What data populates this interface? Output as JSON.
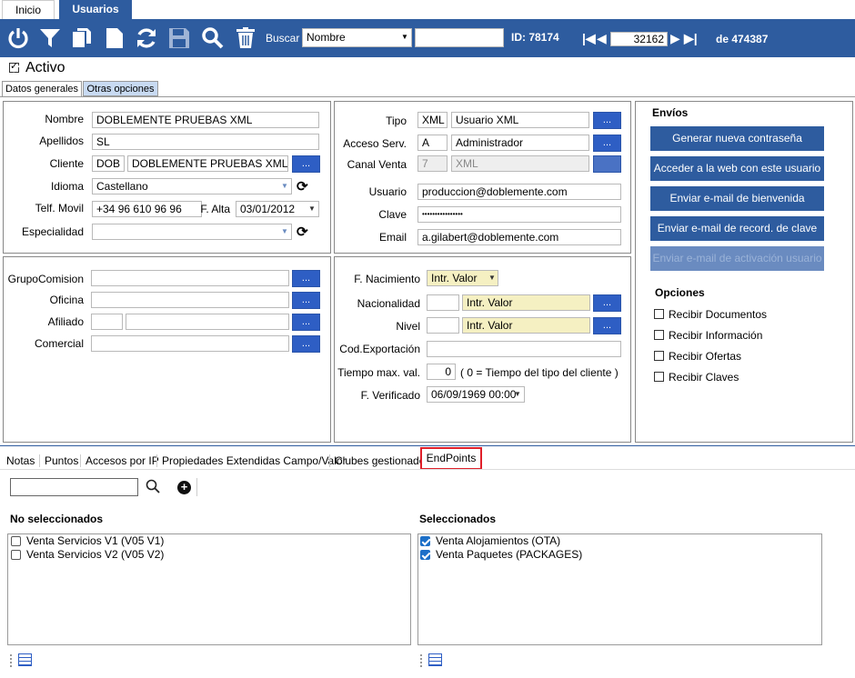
{
  "tabs": {
    "inicio": "Inicio",
    "usuarios": "Usuarios"
  },
  "toolbar": {
    "buscar_label": "Buscar",
    "buscar_select": "Nombre",
    "buscar_value": "",
    "id_label": "ID: 78174",
    "record": "32162",
    "total": "de 474387"
  },
  "activo": "Activo",
  "subtabs": {
    "datos": "Datos generales",
    "otras": "Otras opciones"
  },
  "left": {
    "nombre_label": "Nombre",
    "nombre": "DOBLEMENTE PRUEBAS XML",
    "apellidos_label": "Apellidos",
    "apellidos": "SL",
    "cliente_label": "Cliente",
    "cliente_code": "DOB",
    "cliente_name": "DOBLEMENTE PRUEBAS XML",
    "idioma_label": "Idioma",
    "idioma": "Castellano",
    "telf_label": "Telf. Movil",
    "telf": "+34 96 610 96 96",
    "falta_label": "F. Alta",
    "falta": "03/01/2012",
    "especialidad_label": "Especialidad",
    "especialidad": "",
    "grupo_label": "GrupoComision",
    "oficina_label": "Oficina",
    "afiliado_label": "Afiliado",
    "comercial_label": "Comercial"
  },
  "mid": {
    "tipo_label": "Tipo",
    "tipo_code": "XML",
    "tipo_name": "Usuario XML",
    "acceso_label": "Acceso Serv.",
    "acceso_code": "A",
    "acceso_name": "Administrador",
    "canal_label": "Canal Venta",
    "canal_code": "7",
    "canal_name": "XML",
    "usuario_label": "Usuario",
    "usuario": "produccion@doblemente.com",
    "clave_label": "Clave",
    "clave": "••••••••••••••••",
    "email_label": "Email",
    "email": "a.gilabert@doblemente.com",
    "fnac_label": "F. Nacimiento",
    "fnac": "Intr. Valor",
    "nac_label": "Nacionalidad",
    "nac": "Intr. Valor",
    "nivel_label": "Nivel",
    "nivel": "Intr. Valor",
    "codexp_label": "Cod.Exportación",
    "tiempo_label": "Tiempo max. val.",
    "tiempo": "0",
    "tiempo_note": "( 0 = Tiempo del tipo del cliente )",
    "fver_label": "F. Verificado",
    "fver": "06/09/1969 00:00"
  },
  "envios": {
    "title": "Envíos",
    "buttons": [
      "Generar nueva contraseña",
      "Acceder a la web con este usuario",
      "Enviar e-mail de bienvenida",
      "Enviar e-mail de record. de clave",
      "Enviar e-mail de activación usuario"
    ],
    "opciones_title": "Opciones",
    "opciones": [
      "Recibir Documentos",
      "Recibir Información",
      "Recibir Ofertas",
      "Recibir Claves"
    ]
  },
  "bottom_tabs": [
    "Notas",
    "Puntos",
    "Accesos por IP",
    "Propiedades Extendidas Campo/Valor",
    "Clubes gestionados",
    "EndPoints"
  ],
  "endpoints": {
    "no_sel_title": "No seleccionados",
    "sel_title": "Seleccionados",
    "no_sel": [
      "Venta Servicios V1 (V05 V1)",
      "Venta Servicios V2 (V05 V2)"
    ],
    "sel": [
      "Venta Alojamientos (OTA)",
      "Venta Paquetes (PACKAGES)"
    ]
  },
  "colors": {
    "toolbar": "#2e5c9f",
    "accent_button": "#2e5ec4",
    "highlight": "#e0202a"
  }
}
